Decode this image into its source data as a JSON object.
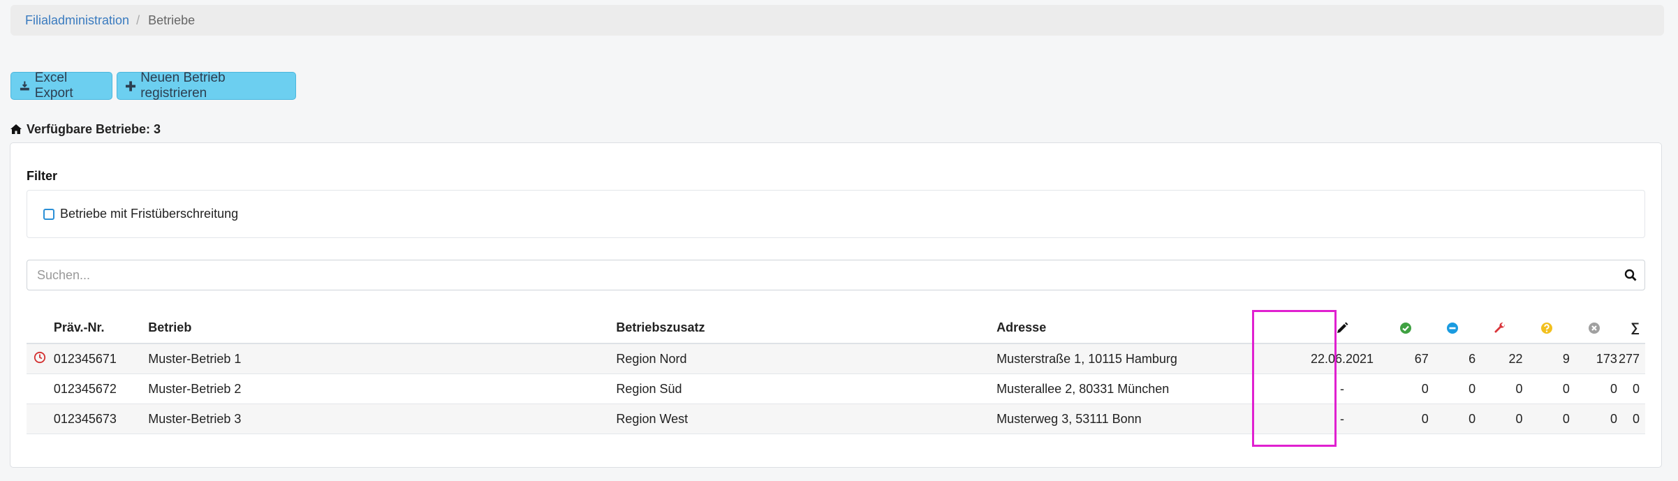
{
  "breadcrumb": {
    "parent": "Filialadministration",
    "separator": "/",
    "current": "Betriebe"
  },
  "toolbar": {
    "export_label": "Excel Export",
    "new_label": "Neuen Betrieb registrieren"
  },
  "summary": {
    "label": "Verfügbare Betriebe: 3"
  },
  "filter": {
    "title": "Filter",
    "checkbox_label": "Betriebe mit Fristüberschreitung"
  },
  "search": {
    "placeholder": "Suchen...",
    "value": ""
  },
  "table": {
    "headers": {
      "nr": "Präv.-Nr.",
      "name": "Betrieb",
      "zusatz": "Betriebszusatz",
      "address": "Adresse",
      "sum": "∑"
    },
    "status_icons": [
      "pencil-icon",
      "check-circle-icon",
      "minus-circle-icon",
      "wrench-icon",
      "question-circle-icon",
      "x-circle-icon"
    ],
    "rows": [
      {
        "nr": "012345671",
        "name": "Muster-Betrieb 1",
        "zusatz": "Region Nord",
        "address": "Musterstraße 1, 10115 Hamburg",
        "date": "22.06.2021",
        "ok": "67",
        "minus": "6",
        "repair": "22",
        "question": "9",
        "cross": "173",
        "sum": "277",
        "overdue": true
      },
      {
        "nr": "012345672",
        "name": "Muster-Betrieb 2",
        "zusatz": "Region Süd",
        "address": "Musterallee 2, 80331 München",
        "date": "-",
        "ok": "0",
        "minus": "0",
        "repair": "0",
        "question": "0",
        "cross": "0",
        "sum": "0",
        "overdue": false
      },
      {
        "nr": "012345673",
        "name": "Muster-Betrieb 3",
        "zusatz": "Region West",
        "address": "Musterweg 3, 53111 Bonn",
        "date": "-",
        "ok": "0",
        "minus": "0",
        "repair": "0",
        "question": "0",
        "cross": "0",
        "sum": "0",
        "overdue": false
      }
    ]
  },
  "colors": {
    "link": "#3a7bbf",
    "button": "#6ccff0",
    "ok": "#3fa142",
    "minus": "#1a9be0",
    "repair": "#d9343a",
    "question": "#f2c01e",
    "cross": "#a0a0a0",
    "overdue": "#d32f2f",
    "highlight": "#e020d0"
  }
}
